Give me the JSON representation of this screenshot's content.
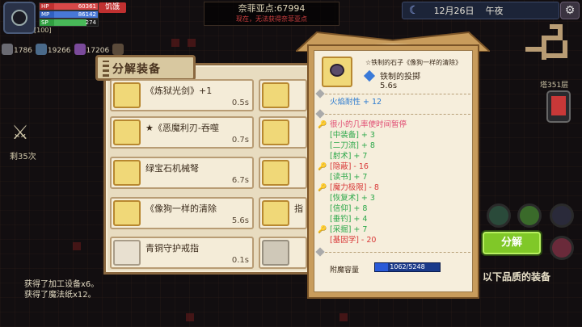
{
  "hud": {
    "hp_label": "HP",
    "hp_value": "60361",
    "mp_label": "MP",
    "mp_value": "86142",
    "sp_label": "SP",
    "sp_value": "274",
    "status_badge": "饥饿",
    "level_text": "[100]",
    "resources": [
      {
        "icon": "gear-icon",
        "value": "1786"
      },
      {
        "icon": "bolt-icon",
        "value": "19266"
      },
      {
        "icon": "gem-icon",
        "value": "17206"
      },
      {
        "icon": "box-icon",
        "value": ""
      }
    ],
    "exploration_title": "奈菲亚点:67994",
    "exploration_warning": "现在，无法获得奈菲亚点",
    "date": "12月26日",
    "time_of_day": "午夜",
    "settings_icon": "gear-icon"
  },
  "right": {
    "floor_label": "塔351层",
    "decompose_button": "分解",
    "quality_label": "以下品质的装备"
  },
  "left": {
    "remaining_label": "剩35次",
    "log": [
      "获得了加工设备x6。",
      "获得了魔法纸x12。"
    ]
  },
  "panel": {
    "title": "分解装备",
    "items": [
      {
        "name": "《炼狱光剑》+1",
        "time": "0.5s",
        "icon": "sword-icon"
      },
      {
        "name": "★《恶魔利刃-吞噬",
        "time": "0.7s",
        "icon": "scythe-icon"
      },
      {
        "name": "绿宝石机械弩",
        "time": "6.7s",
        "icon": "crossbow-icon"
      },
      {
        "name": "《像狗一样的清除",
        "time": "5.6s",
        "icon": "stone-icon"
      },
      {
        "name": "青铜守护戒指",
        "time": "0.1s",
        "icon": "ring-icon"
      }
    ],
    "right_items": [
      {
        "name": "",
        "icon": "sword-icon"
      },
      {
        "name": "",
        "icon": "armor-icon"
      },
      {
        "name": "",
        "icon": "amulet-icon"
      },
      {
        "name": "指",
        "icon": "ring-icon"
      },
      {
        "name": "",
        "icon": "empty-slot-icon"
      }
    ]
  },
  "tooltip": {
    "title": "☆铁制的石子《像狗一样的清除》",
    "type": "铁制的投掷",
    "time": "5.6s",
    "base_stat": "火焰耐性 + 12",
    "stats": [
      {
        "text": "很小的几率使时间暂停",
        "color": "pink",
        "key": true
      },
      {
        "text": "[中装备] + 3",
        "color": "green",
        "key": false
      },
      {
        "text": "[二刀流] + 8",
        "color": "green",
        "key": false
      },
      {
        "text": "[射术] + 7",
        "color": "green",
        "key": false
      },
      {
        "text": "[隐蔽] - 16",
        "color": "red",
        "key": true
      },
      {
        "text": "[读书] + 7",
        "color": "green",
        "key": false
      },
      {
        "text": "[魔力极限] - 8",
        "color": "red",
        "key": true
      },
      {
        "text": "[恢复术] + 3",
        "color": "green",
        "key": false
      },
      {
        "text": "[信仰] + 8",
        "color": "green",
        "key": false
      },
      {
        "text": "[垂钓] + 4",
        "color": "green",
        "key": false
      },
      {
        "text": "[采掘] + 7",
        "color": "green",
        "key": true
      },
      {
        "text": "[基因学] - 20",
        "color": "red",
        "key": false
      }
    ],
    "capacity_label": "附魔容量",
    "capacity_value": "1062/5248",
    "capacity_fraction": 0.2024
  },
  "colors": {
    "accent_green": "#80c828",
    "panel_bg": "#e8dcc0",
    "stat_green": "#2ca84a",
    "stat_red": "#d83838",
    "stat_pink": "#e04870",
    "stat_blue": "#2a7ad0"
  }
}
